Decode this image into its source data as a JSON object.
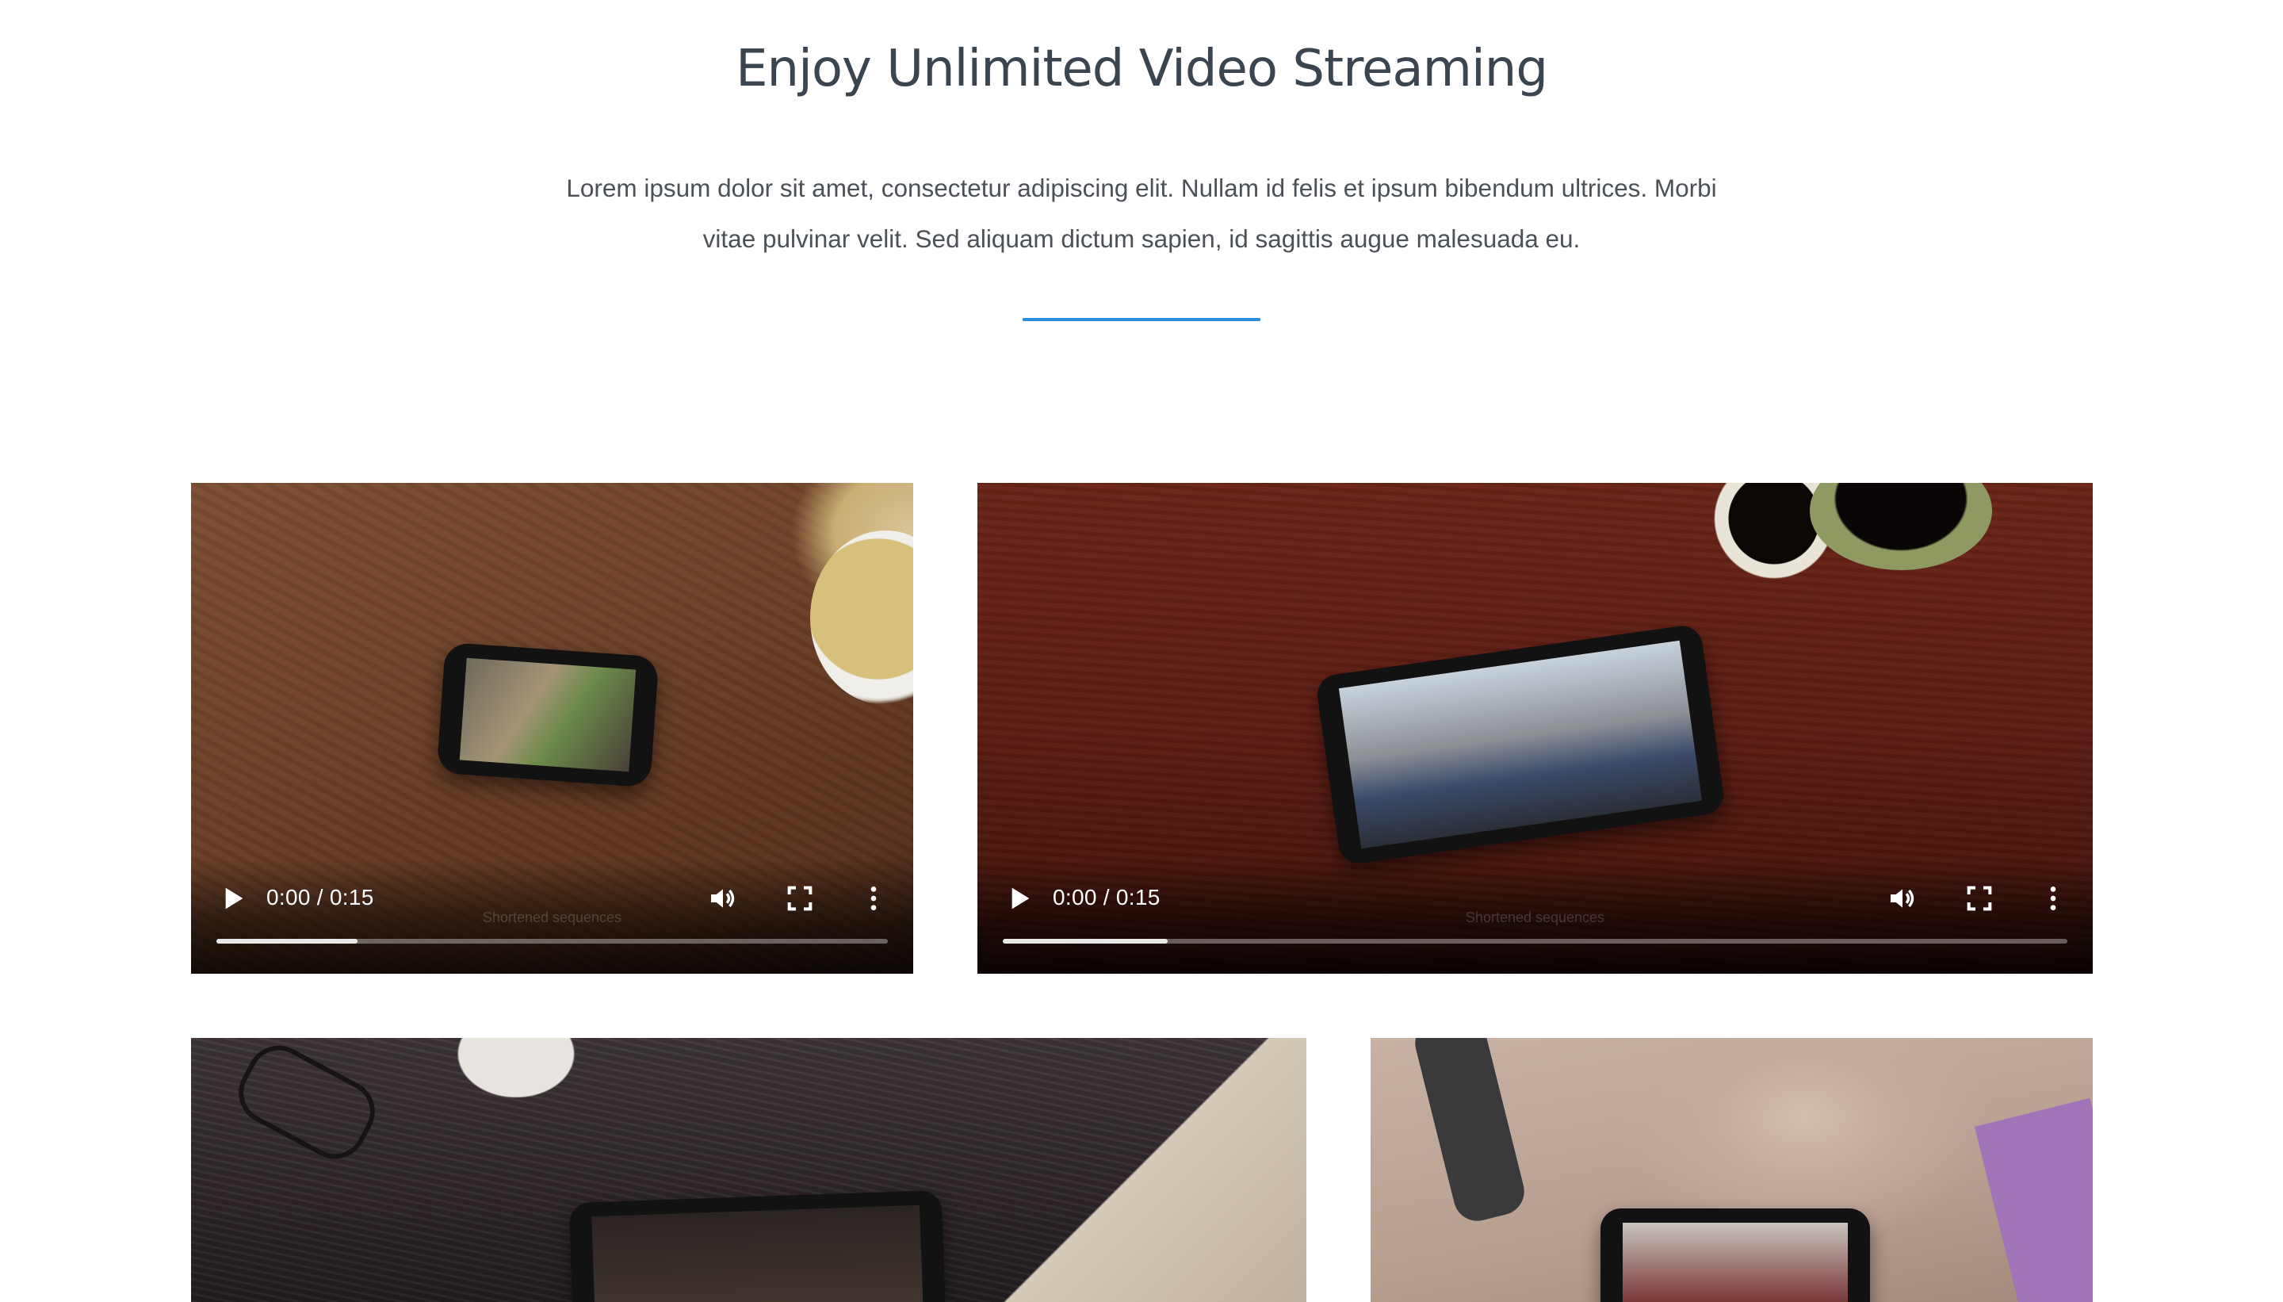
{
  "header": {
    "title": "Enjoy Unlimited Video Streaming",
    "intro": "Lorem ipsum dolor sit amet, consectetur adipiscing elit. Nullam id felis et ipsum bibendum ultrices. Morbi vitae pulvinar velit. Sed aliquam dictum sapien, id sagittis augue malesuada eu."
  },
  "accent_color": "#2c8fdc",
  "videos": [
    {
      "time": "0:00 / 0:15",
      "caption": "Shortened sequences",
      "buffered_fraction": 0.21
    },
    {
      "time": "0:00 / 0:15",
      "caption": "Shortened sequences",
      "buffered_fraction": 0.155
    },
    {
      "time": "",
      "caption": ""
    },
    {
      "time": "",
      "caption": ""
    }
  ],
  "controls": {
    "play_icon": "play-icon",
    "volume_icon": "volume-icon",
    "fullscreen_icon": "fullscreen-icon",
    "more_icon": "more-options-icon"
  }
}
